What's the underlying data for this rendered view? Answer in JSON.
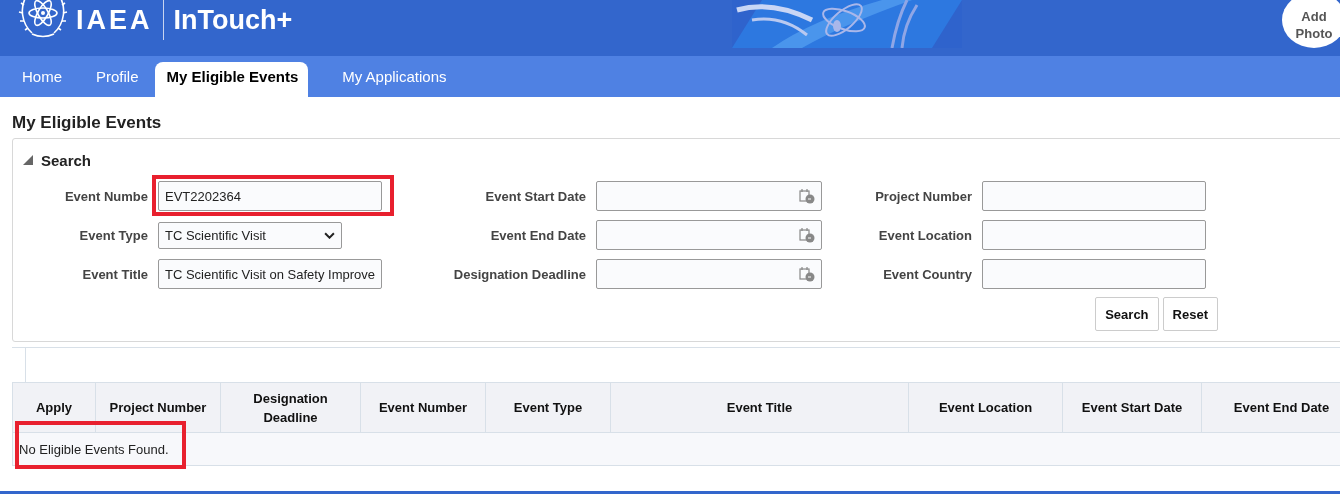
{
  "header": {
    "logo_text": "IAEA",
    "app_name": "InTouch+",
    "avatar_label": "Add Photo"
  },
  "tabs": [
    {
      "label": "Home",
      "selected": false
    },
    {
      "label": "Profile",
      "selected": false
    },
    {
      "label": "My Eligible Events",
      "selected": true
    },
    {
      "label": "My Applications",
      "selected": false
    }
  ],
  "page_title": "My Eligible Events",
  "search": {
    "title": "Search",
    "expanded": true,
    "fields": [
      {
        "kind": "text",
        "label": "Event Numbe",
        "value": "EVT2202364",
        "highlighted": true
      },
      {
        "kind": "date",
        "label": "Event Start Date",
        "highlighted": false
      },
      {
        "kind": "text",
        "label": "Project Number",
        "highlighted": false
      },
      {
        "kind": "select",
        "label": "Event Type",
        "value": "TC Scientific Visit",
        "highlighted": false
      },
      {
        "kind": "date",
        "label": "Event End Date",
        "highlighted": false
      },
      {
        "kind": "text",
        "label": "Event Location",
        "highlighted": false
      },
      {
        "kind": "text",
        "label": "Event Title",
        "value": "TC Scientific Visit on Safety Improve",
        "highlighted": false
      },
      {
        "kind": "date",
        "label": "Designation Deadline",
        "highlighted": false
      },
      {
        "kind": "text",
        "label": "Event Country",
        "highlighted": false
      }
    ],
    "buttons": [
      "Search",
      "Reset"
    ]
  },
  "table": {
    "columns": [
      "Apply",
      "Project Number",
      "Designation Deadline",
      "Event Number",
      "Event Type",
      "Event Title",
      "Event Location",
      "Event Start Date",
      "Event End Date"
    ],
    "empty_message": "No Eligible Events Found.",
    "empty_highlighted": true
  }
}
